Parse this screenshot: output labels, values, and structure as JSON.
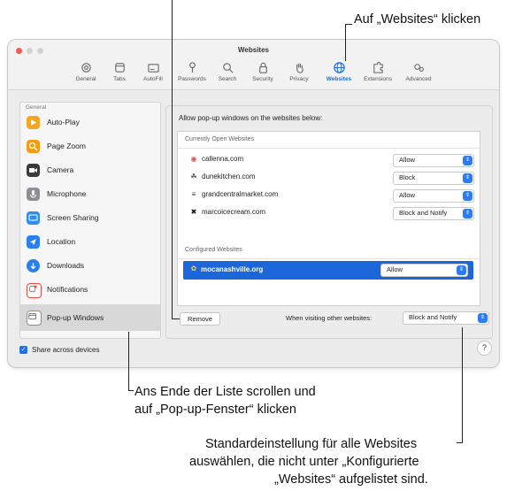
{
  "callouts": {
    "websites": "Auf „Websites“ klicken",
    "popup_line1": "Ans Ende der Liste scrollen und",
    "popup_line2": "auf „Pop-up-Fenster“ klicken",
    "default_line1": "Standardeinstellung für alle Websites",
    "default_line2": "auswählen, die nicht unter „Konfigurierte",
    "default_line3": "„Websites“ aufgelistet sind."
  },
  "window": {
    "title": "Websites",
    "toolbar": [
      {
        "label": "General",
        "icon": "gear-icon"
      },
      {
        "label": "Tabs",
        "icon": "tabs-icon"
      },
      {
        "label": "AutoFill",
        "icon": "autofill-icon"
      },
      {
        "label": "Passwords",
        "icon": "key-icon"
      },
      {
        "label": "Search",
        "icon": "search-icon"
      },
      {
        "label": "Security",
        "icon": "lock-icon"
      },
      {
        "label": "Privacy",
        "icon": "hand-icon"
      },
      {
        "label": "Websites",
        "icon": "globe-icon"
      },
      {
        "label": "Extensions",
        "icon": "puzzle-icon"
      },
      {
        "label": "Advanced",
        "icon": "gears-icon"
      }
    ]
  },
  "sidebar": {
    "header": "General",
    "items": [
      {
        "label": "Auto-Play",
        "color": "#f5a623"
      },
      {
        "label": "Page Zoom",
        "color": "#f39c12"
      },
      {
        "label": "Camera",
        "color": "#3a3a3a"
      },
      {
        "label": "Microphone",
        "color": "#8e8e93"
      },
      {
        "label": "Screen Sharing",
        "color": "#2f8cf2"
      },
      {
        "label": "Location",
        "color": "#2a7ef0"
      },
      {
        "label": "Downloads",
        "color": "#2a7ef0"
      },
      {
        "label": "Notifications",
        "color": "#e74c3c"
      },
      {
        "label": "Pop-up Windows",
        "color": "#8e8e93"
      }
    ],
    "share_label": "Share across devices"
  },
  "main": {
    "allow_text": "Allow pop-up windows on the websites below:",
    "open_header": "Currently Open Websites",
    "open_sites": [
      {
        "site": "callenna.com",
        "value": "Allow"
      },
      {
        "site": "dunekitchen.com",
        "value": "Block"
      },
      {
        "site": "grandcentralmarket.com",
        "value": "Allow"
      },
      {
        "site": "marcoicecream.com",
        "value": "Block and Notify"
      }
    ],
    "configured_header": "Configured Websites",
    "configured_sites": [
      {
        "site": "mocanashville.org",
        "value": "Allow"
      }
    ],
    "remove_label": "Remove",
    "other_label": "When visiting other websites:",
    "other_value": "Block and Notify",
    "help_label": "?"
  },
  "colors": {
    "accent": "#1b66d8",
    "active_tab": "#1a6fe0"
  }
}
